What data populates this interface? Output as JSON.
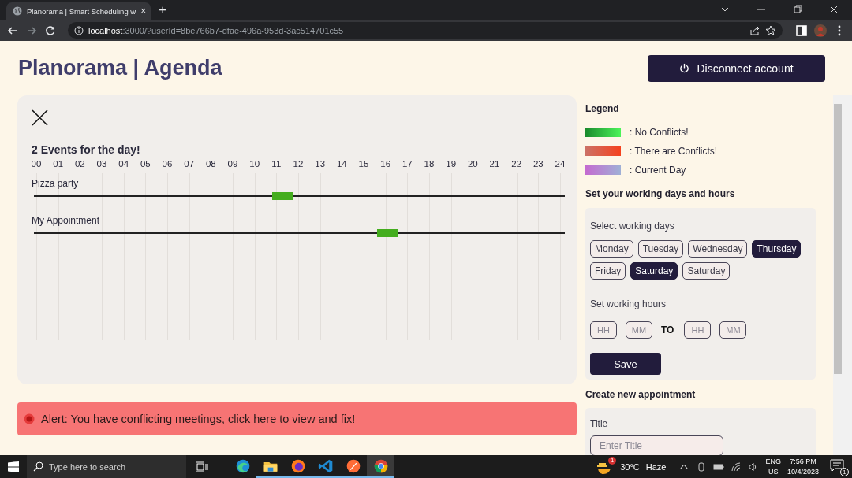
{
  "browser": {
    "tab_title": "Planorama | Smart Scheduling w",
    "tab_close": "×",
    "new_tab": "+",
    "url_host": "localhost",
    "url_rest": ":3000/?userId=8be766b7-dfae-496a-953d-3ac514701c55"
  },
  "page": {
    "title": "Planorama | Agenda",
    "disconnect_button": "Disconnect account"
  },
  "day_view": {
    "heading": "2 Events for the day!",
    "hours": [
      "00",
      "01",
      "02",
      "03",
      "04",
      "05",
      "06",
      "07",
      "08",
      "09",
      "10",
      "11",
      "12",
      "13",
      "14",
      "15",
      "16",
      "17",
      "18",
      "19",
      "20",
      "21",
      "22",
      "23",
      "24"
    ],
    "events": [
      {
        "name": "Pizza party",
        "level": 0.45
      },
      {
        "name": "My Appointment",
        "level": 0.65
      }
    ]
  },
  "alert": {
    "text": "Alert: You have conflicting meetings, click here to view and fix!"
  },
  "legend": {
    "heading": "Legend",
    "items": [
      {
        "kind": "no_conflicts",
        "label": ": No Conflicts!"
      },
      {
        "kind": "conflicts",
        "label": ": There are Conflicts!"
      },
      {
        "kind": "current_day",
        "label": ": Current Day"
      }
    ]
  },
  "working_hours": {
    "heading": "Set your working days and hours",
    "days_label": "Select working days",
    "days": [
      {
        "label": "Monday",
        "selected": false
      },
      {
        "label": "Tuesday",
        "selected": false
      },
      {
        "label": "Wednesday",
        "selected": false
      },
      {
        "label": "Thursday",
        "selected": true
      },
      {
        "label": "Friday",
        "selected": false
      },
      {
        "label": "Saturday",
        "selected": true
      },
      {
        "label": "Saturday",
        "selected": false
      }
    ],
    "hours_label": "Set working hours",
    "from_fields": [
      {
        "placeholder": "HH"
      },
      {
        "placeholder": "MM"
      }
    ],
    "separator": "TO",
    "to_fields": [
      {
        "placeholder": "HH"
      },
      {
        "placeholder": "MM"
      }
    ],
    "save_button": "Save"
  },
  "appointment": {
    "heading": "Create new appointment",
    "title_label": "Title",
    "title_field": {
      "placeholder": "Enter Title"
    }
  },
  "taskbar": {
    "search": {
      "placeholder": "Type here to search"
    },
    "apps": [
      {
        "kind": "edge",
        "running": false,
        "selected": false
      },
      {
        "kind": "files",
        "running": true,
        "selected": false
      },
      {
        "kind": "firefox",
        "running": true,
        "selected": false
      },
      {
        "kind": "vscode",
        "running": true,
        "selected": false
      },
      {
        "kind": "postman",
        "running": true,
        "selected": false
      },
      {
        "kind": "chrome",
        "running": true,
        "selected": true
      }
    ],
    "weather_badge": "1",
    "temperature": "30°C",
    "weather": "Haze",
    "language": "ENG",
    "region": "US",
    "time": "7:56 PM",
    "date": "10/4/2023",
    "notifications": "1"
  }
}
